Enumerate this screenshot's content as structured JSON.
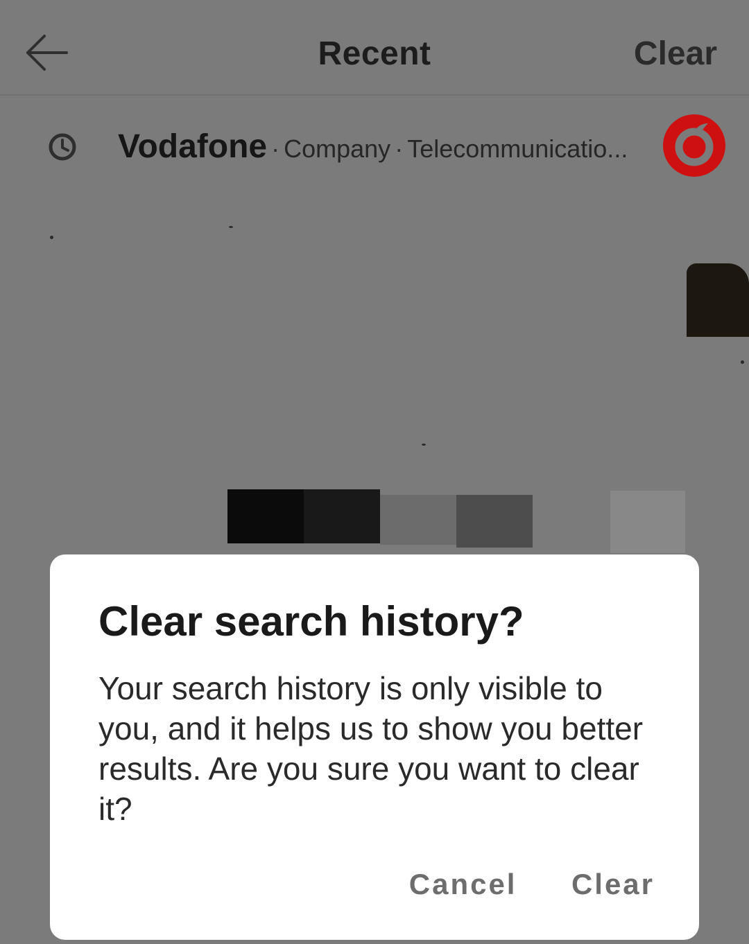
{
  "header": {
    "title": "Recent",
    "clear_label": "Clear",
    "back_icon": "arrow-left-icon"
  },
  "recent": {
    "items": [
      {
        "icon": "history-clock-icon",
        "name": "Vodafone",
        "type": "Company",
        "category": "Telecommunicatio...",
        "logo": "vodafone-logo",
        "logo_color": "#e60000"
      }
    ]
  },
  "dialog": {
    "title": "Clear search history?",
    "body": "Your search history is only visible to you, and it helps us to show you better results. Are you sure you want to clear it?",
    "cancel_label": "Cancel",
    "clear_label": "Clear"
  },
  "colors": {
    "scrim_background": "#7b7b7b",
    "dialog_background": "#ffffff",
    "button_text": "#6d6d6d"
  }
}
